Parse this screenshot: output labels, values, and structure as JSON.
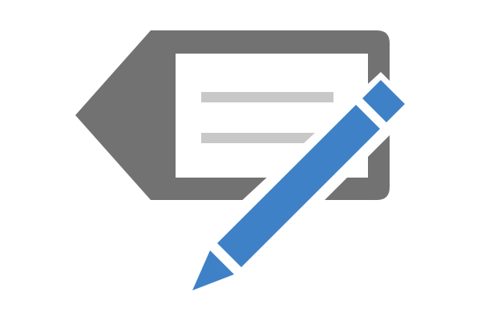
{
  "icon": {
    "name": "edit-tag-icon",
    "tag_name": "tag-icon",
    "pencil_name": "pencil-icon"
  },
  "colors": {
    "background": "#ffffff",
    "tag_fill": "#727272",
    "label_fill": "#ffffff",
    "text_lines": "#c8c8c8",
    "pencil": "#3f81c6",
    "pencil_gap": "#ffffff"
  }
}
